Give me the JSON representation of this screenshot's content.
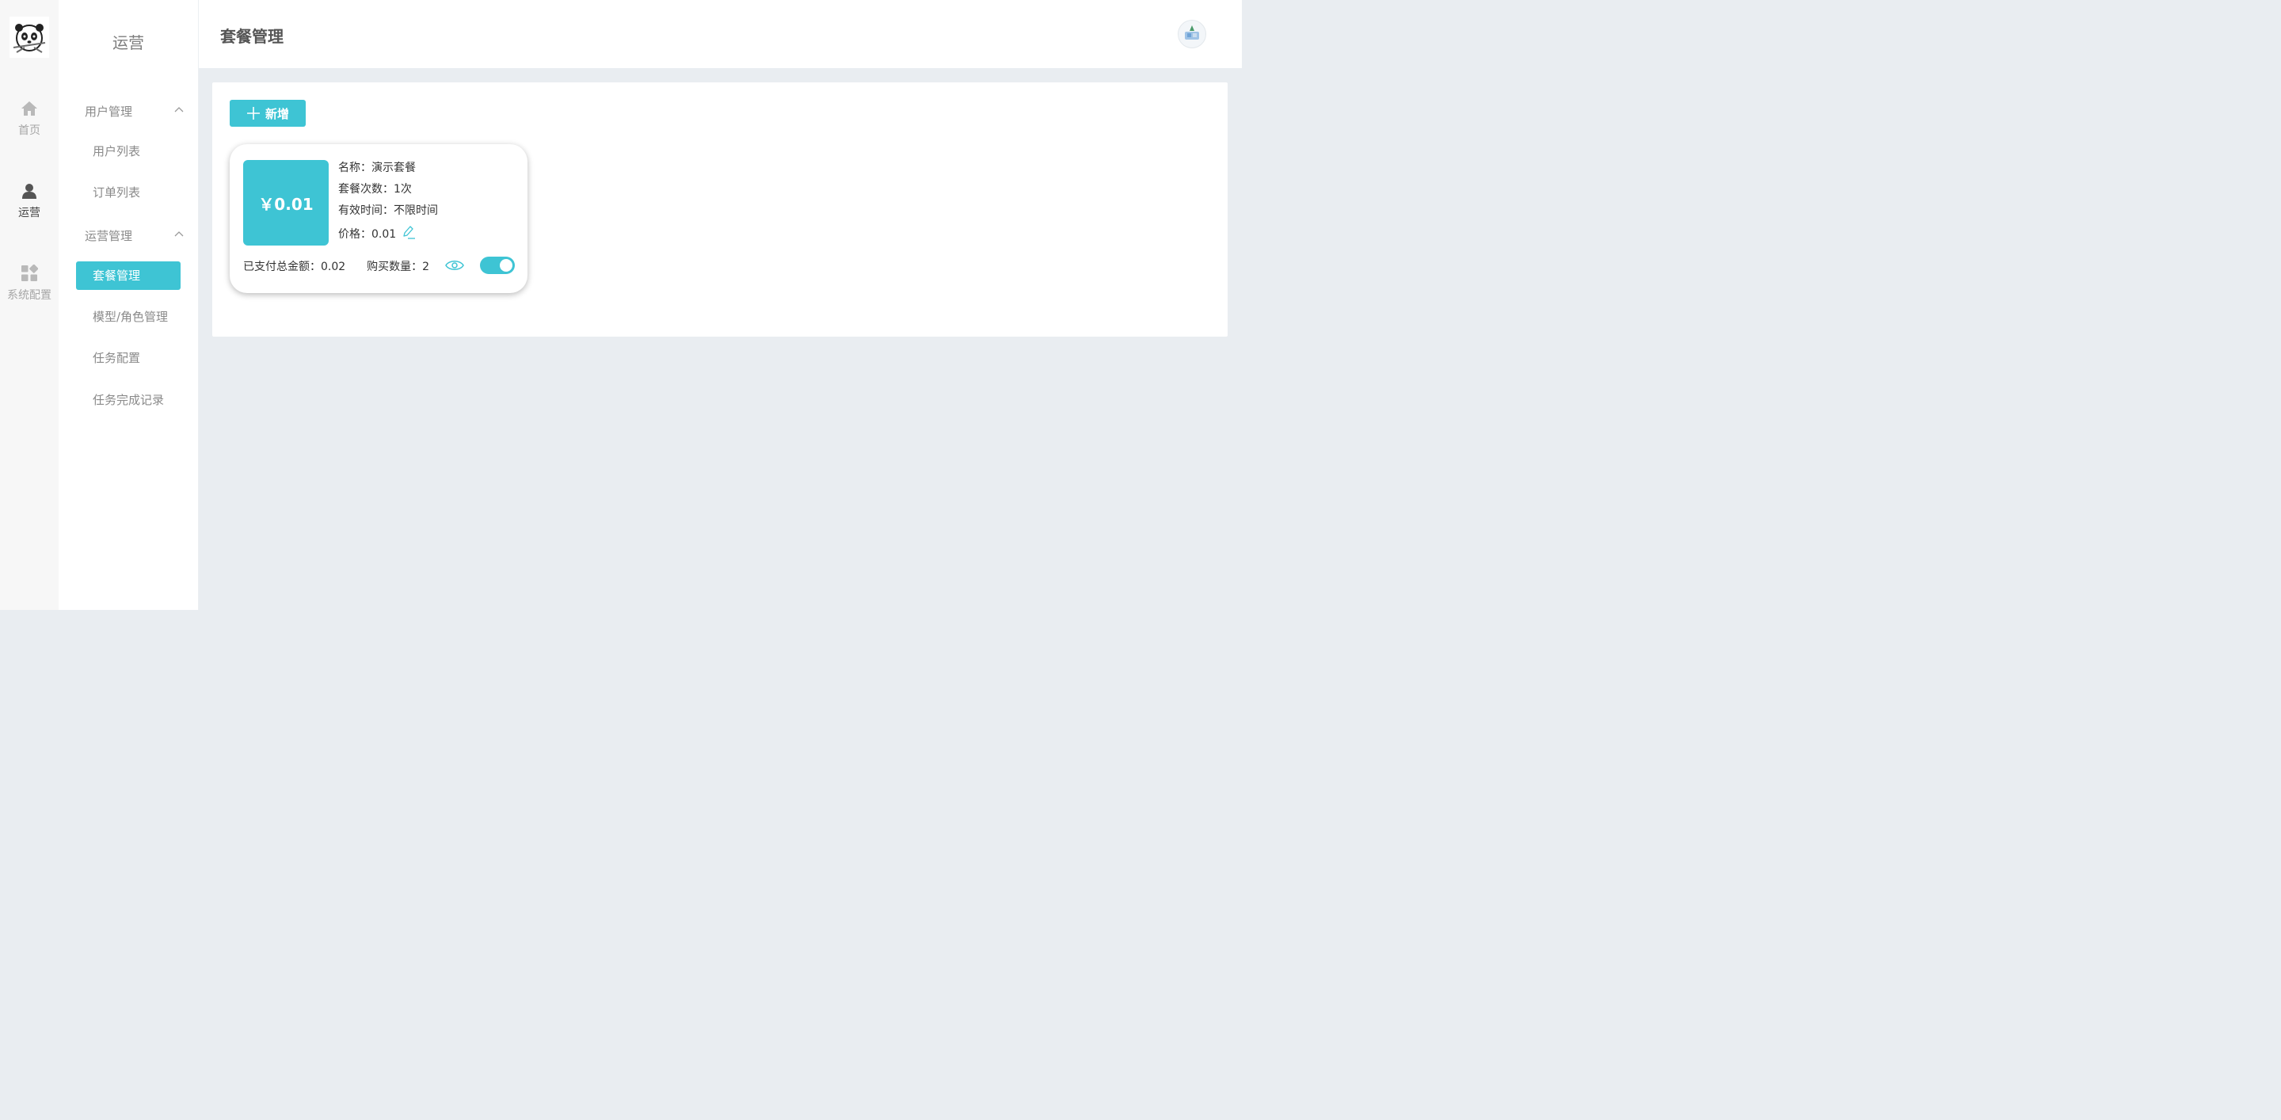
{
  "rail": {
    "items": [
      {
        "label": "首页",
        "icon": "home-icon"
      },
      {
        "label": "运营",
        "icon": "user-icon",
        "active": true
      },
      {
        "label": "系统配置",
        "icon": "apps-icon"
      }
    ]
  },
  "submenu": {
    "title": "运营",
    "groups": [
      {
        "label": "用户管理",
        "expanded": true,
        "items": [
          "用户列表",
          "订单列表"
        ]
      },
      {
        "label": "运营管理",
        "expanded": true,
        "items": [
          "套餐管理",
          "模型/角色管理",
          "任务配置",
          "任务完成记录"
        ]
      }
    ],
    "active_item": "套餐管理"
  },
  "header": {
    "title": "套餐管理"
  },
  "toolbar": {
    "add_label": "新增"
  },
  "package_card": {
    "price_display": "￥0.01",
    "name_line": "名称：演示套餐",
    "count_line": "套餐次数：1次",
    "validity_line": "有效时间：不限时间",
    "price_line": "价格：0.01",
    "paid_total_line": "已支付总金额：0.02",
    "purchase_count_line": "购买数量：2",
    "enabled": true
  },
  "colors": {
    "accent": "#3ec4d4",
    "background": "#e9edf1"
  }
}
